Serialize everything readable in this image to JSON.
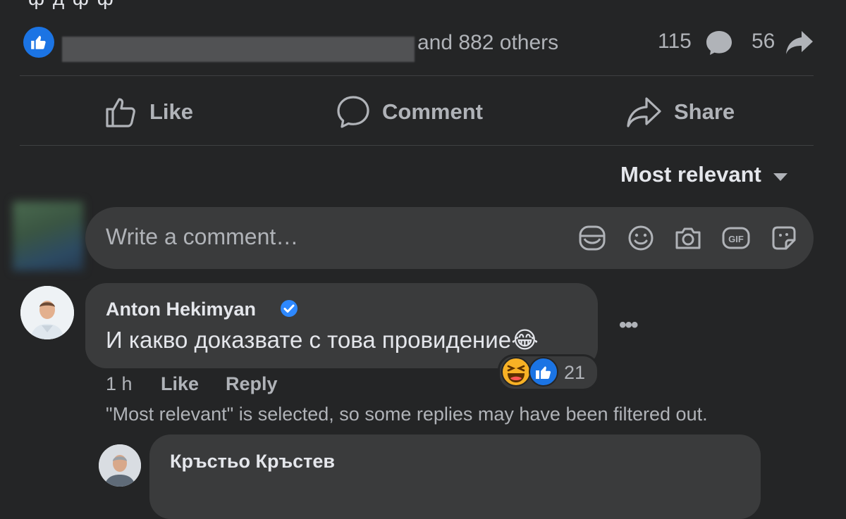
{
  "post": {
    "top_text": "ф д ф ф",
    "reactions_text": "and 882 others",
    "comments_count": "115",
    "shares_count": "56"
  },
  "actions": {
    "like": "Like",
    "comment": "Comment",
    "share": "Share"
  },
  "sort": {
    "label": "Most relevant"
  },
  "composer": {
    "placeholder": "Write a comment…"
  },
  "comments": [
    {
      "author": "Anton Hekimyan",
      "verified": true,
      "text": "И какво доказвате с това провидение😂",
      "time": "1 h",
      "like_label": "Like",
      "reply_label": "Reply",
      "reaction_count": "21",
      "reactions": [
        "haha",
        "like"
      ]
    }
  ],
  "filter_note": "\"Most relevant\" is selected, so some replies may have been filtered out.",
  "reply": {
    "author": "Кръстьо Кръстев"
  },
  "colors": {
    "background": "#242526",
    "bubble": "#3a3b3c",
    "text_primary": "#e4e6eb",
    "text_secondary": "#b0b3b8",
    "like_blue": "#1b74e4",
    "verified_blue": "#2d88ff"
  },
  "icons": [
    "like-icon",
    "comment-icon",
    "share-icon",
    "chevron-down-icon",
    "avatar-sticker-icon",
    "emoji-icon",
    "camera-icon",
    "gif-icon",
    "sticker-icon",
    "verified-badge-icon",
    "more-options-icon",
    "haha-reaction-icon",
    "like-reaction-icon"
  ]
}
